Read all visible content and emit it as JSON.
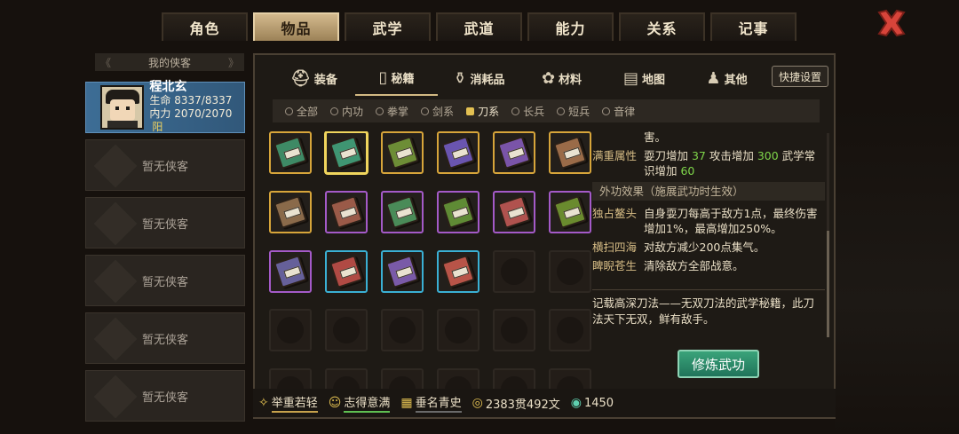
{
  "top_tabs": [
    "角色",
    "物品",
    "武学",
    "武道",
    "能力",
    "关系",
    "记事"
  ],
  "active_top_tab": 1,
  "hero_panel": {
    "header": "我的侠客",
    "active_hero": {
      "name": "程北玄",
      "hp": "生命 8337/8337",
      "mp": "内力 2070/2070",
      "tag": "阳"
    },
    "empty_label": "暂无侠客"
  },
  "sub_tabs": [
    {
      "label": "装备",
      "icon": "equipment-icon"
    },
    {
      "label": "秘籍",
      "icon": "manual-icon"
    },
    {
      "label": "消耗品",
      "icon": "consumable-icon"
    },
    {
      "label": "材料",
      "icon": "material-icon"
    },
    {
      "label": "地图",
      "icon": "map-icon"
    },
    {
      "label": "其他",
      "icon": "other-icon"
    }
  ],
  "active_sub_tab": 1,
  "shortcut_label": "快捷设置",
  "filters": [
    "全部",
    "内功",
    "拳掌",
    "剑系",
    "刀系",
    "长兵",
    "短兵",
    "音律"
  ],
  "active_filter": 4,
  "items": [
    {
      "book": "#3e8a65",
      "frame": "#d7a53a"
    },
    {
      "book": "#3f9572",
      "frame": "#f0d55d",
      "selected": true
    },
    {
      "book": "#6d8d36",
      "frame": "#d7a53a"
    },
    {
      "book": "#6a55b0",
      "frame": "#d7a53a"
    },
    {
      "book": "#7a54a8",
      "frame": "#d7a53a"
    },
    {
      "book": "#9a6b48",
      "frame": "#d7a53a"
    },
    {
      "book": "#8a6a4a",
      "frame": "#d7a53a"
    },
    {
      "book": "#9a5a48",
      "frame": "#a45ac8"
    },
    {
      "book": "#4a8b58",
      "frame": "#a45ac8"
    },
    {
      "book": "#5f8b35",
      "frame": "#a45ac8"
    },
    {
      "book": "#b0524e",
      "frame": "#a45ac8"
    },
    {
      "book": "#6a8b2e",
      "frame": "#a45ac8"
    },
    {
      "book": "#66609a",
      "frame": "#a45ac8"
    },
    {
      "book": "#b04a44",
      "frame": "#3ab0d4"
    },
    {
      "book": "#7a5aa8",
      "frame": "#3ab0d4"
    },
    {
      "book": "#b85448",
      "frame": "#3ab0d4"
    }
  ],
  "total_slots": 30,
  "detail": {
    "top_line": "害。",
    "full_attr_label": "满重属性",
    "full_attr_parts": [
      "耍刀增加 ",
      "37",
      " 攻击增加 ",
      "300",
      " 武学常识增加 ",
      "60"
    ],
    "section_title": "外功效果（施展武功时生效）",
    "effects": [
      {
        "name": "独占鳌头",
        "text": "自身耍刀每高于敌方1点，最终伤害增加1%，最高增加250%。"
      },
      {
        "name": "横扫四海",
        "text": "对敌方减少200点集气。"
      },
      {
        "name": "睥睨苍生",
        "text": "清除敌方全部战意。"
      }
    ],
    "description": "记载高深刀法——无双刀法的武学秘籍，此刀法天下无双，鲜有敌手。",
    "practice_button": "修炼武功"
  },
  "status": {
    "s1": "举重若轻",
    "s2": "志得意满",
    "s3": "垂名青史",
    "money": "2383贯492文",
    "gems": "1450"
  },
  "colors": {
    "accent_gold": "#d2b983",
    "active_tab": "#d3b98d",
    "practice_green": "#2f8f6a",
    "number_green": "#7fd64a"
  }
}
